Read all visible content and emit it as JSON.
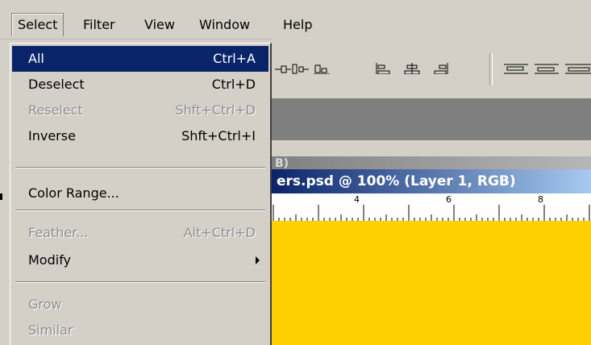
{
  "menubar": {
    "items": [
      "Select",
      "Filter",
      "View",
      "Window",
      "Help"
    ]
  },
  "select_menu": {
    "items": [
      {
        "label": "All",
        "shortcut": "Ctrl+A",
        "state": "highlighted"
      },
      {
        "label": "Deselect",
        "shortcut": "Ctrl+D",
        "state": "enabled"
      },
      {
        "label": "Reselect",
        "shortcut": "Shft+Ctrl+D",
        "state": "disabled"
      },
      {
        "label": "Inverse",
        "shortcut": "Shft+Ctrl+I",
        "state": "enabled"
      },
      {
        "label": "Color Range...",
        "shortcut": "",
        "state": "enabled"
      },
      {
        "label": "Feather...",
        "shortcut": "Alt+Ctrl+D",
        "state": "disabled"
      },
      {
        "label": "Modify",
        "shortcut": "",
        "state": "enabled",
        "submenu": true
      },
      {
        "label": "Grow",
        "shortcut": "",
        "state": "disabled"
      },
      {
        "label": "Similar",
        "shortcut": "",
        "state": "disabled"
      }
    ]
  },
  "inactive_document": {
    "title_fragment": "B)"
  },
  "document": {
    "title": "ers.psd @ 100% (Layer 1, RGB)",
    "ruler_labels": [
      "4",
      "6",
      "8"
    ],
    "canvas_color": "#ffd000"
  },
  "colors": {
    "highlight": "#0a246a",
    "face": "#d4d0c8",
    "title_active": "#0a246a"
  }
}
